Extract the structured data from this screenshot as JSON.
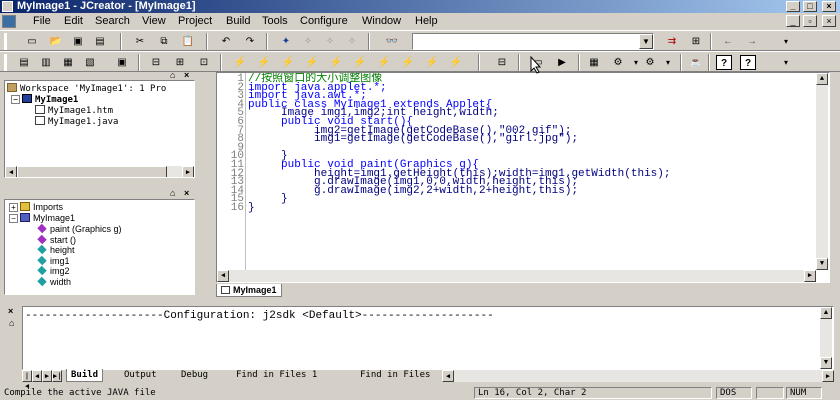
{
  "window": {
    "title": "MyImage1 - JCreator - [MyImage1]"
  },
  "menu": [
    "File",
    "Edit",
    "Search",
    "View",
    "Project",
    "Build",
    "Tools",
    "Configure",
    "Window",
    "Help"
  ],
  "workspace": {
    "header": "Workspace 'MyImage1': 1 Pro",
    "project": "MyImage1",
    "files": [
      "MyImage1.htm",
      "MyImage1.java"
    ]
  },
  "classview": {
    "items": [
      "Imports",
      "MyImage1",
      "paint (Graphics g)",
      "start ()",
      "height",
      "img1",
      "img2",
      "width"
    ]
  },
  "editor": {
    "tab": "MyImage1",
    "line_numbers": [
      "1",
      "2",
      "3",
      "4",
      "5",
      "6",
      "7",
      "8",
      "9",
      "10",
      "11",
      "12",
      "13",
      "14",
      "15",
      "16"
    ],
    "lines": [
      "//按照窗口的大小调整图像",
      "import java.applet.*;",
      "import java.awt.*;",
      "public class MyImage1 extends Applet{",
      "     Image img1,img2;int height,width;",
      "     public void start(){",
      "          img2=getImage(getCodeBase(),\"002.gif\");",
      "          img1=getImage(getCodeBase(),\"girl.jpg\");",
      "",
      "     }",
      "     public void paint(Graphics g){",
      "          height=img1.getHeight(this);width=img1.getWidth(this);",
      "          g.drawImage(img1,0,0,width,height,this);",
      "          g.drawImage(img2,2+width,2+height,this);",
      "     }",
      "}"
    ]
  },
  "output": {
    "text": "---------------------Configuration: j2sdk <Default>--------------------",
    "tabs": [
      "Build",
      "Output",
      "Debug",
      "Find in Files 1",
      "Find in Files"
    ]
  },
  "statusbar": {
    "message": "Compile the active JAVA file",
    "position": "Ln 16, Col 2, Char 2",
    "mode": "DOS",
    "num": "NUM"
  },
  "icons": [
    "app-icon",
    "new-icon",
    "open-icon",
    "save-icon",
    "save-all-icon",
    "cut-icon",
    "copy-icon",
    "paste-icon",
    "undo-icon",
    "redo-icon",
    "binoculars-icon",
    "back-icon",
    "forward-icon",
    "help-icon"
  ]
}
